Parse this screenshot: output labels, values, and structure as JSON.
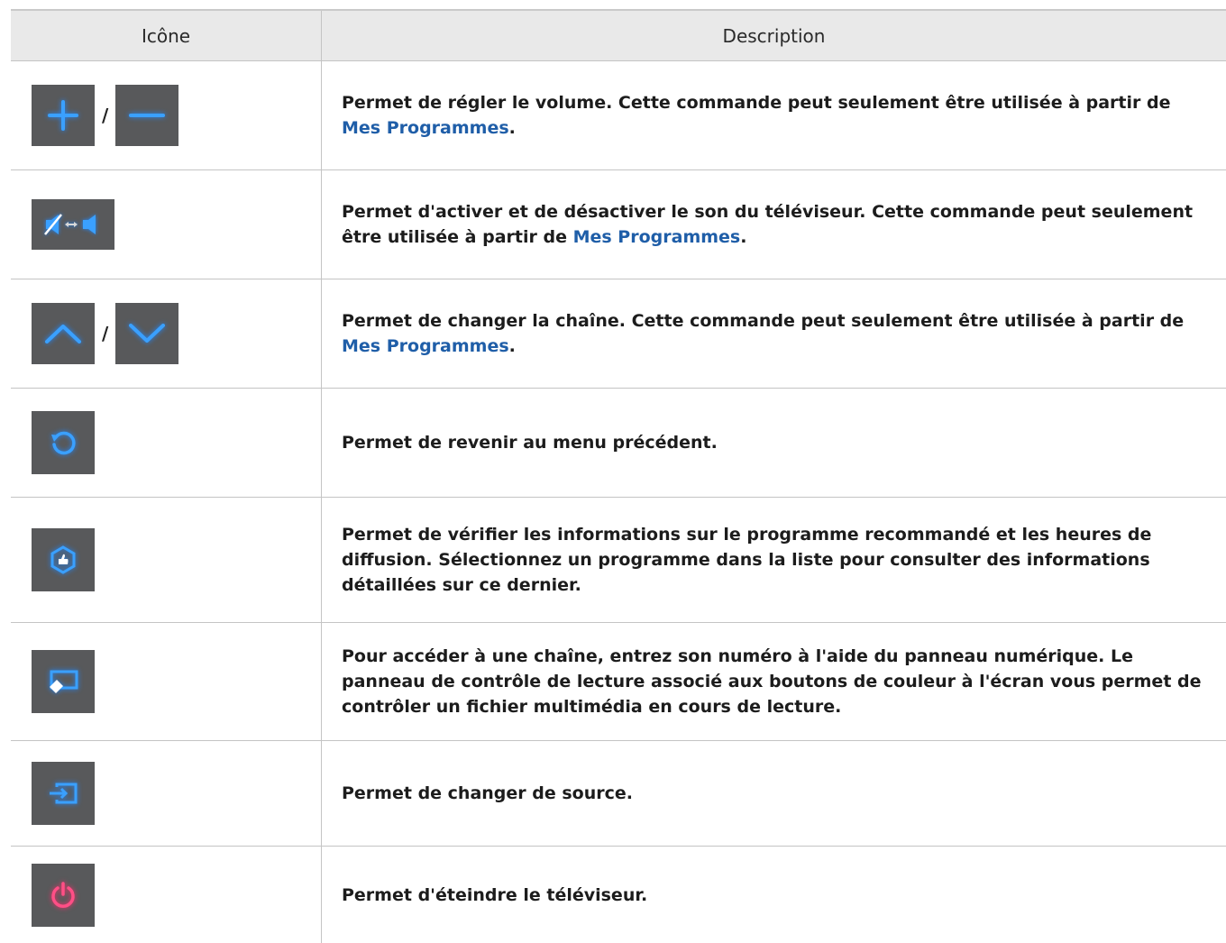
{
  "table": {
    "headers": {
      "icon": "Icône",
      "description": "Description"
    },
    "separator": "/",
    "rows": [
      {
        "icons": [
          "plus-icon",
          "minus-icon"
        ],
        "text": "Permet de régler le volume. Cette commande peut seulement être utilisée à partir de ",
        "link": "Mes Programmes",
        "after": "."
      },
      {
        "icons": [
          "mute-toggle-icon"
        ],
        "text": "Permet d'activer et de désactiver le son du téléviseur. Cette commande peut seulement être utilisée à partir de ",
        "link": "Mes Programmes",
        "after": "."
      },
      {
        "icons": [
          "chevron-up-icon",
          "chevron-down-icon"
        ],
        "text": "Permet de changer la chaîne. Cette commande peut seulement être utilisée à partir de ",
        "link": "Mes Programmes",
        "after": "."
      },
      {
        "icons": [
          "return-icon"
        ],
        "text": "Permet de revenir au menu précédent."
      },
      {
        "icons": [
          "recommendation-icon"
        ],
        "text": "Permet de vérifier les informations sur le programme recommandé et les heures de diffusion. Sélectionnez un programme dans la liste pour consulter des informations détaillées sur ce dernier."
      },
      {
        "icons": [
          "remote-panel-icon"
        ],
        "text": "Pour accéder à une chaîne, entrez son numéro à l'aide du panneau numérique. Le panneau de contrôle de lecture associé aux boutons de couleur à l'écran vous permet de contrôler un fichier multimédia en cours de lecture."
      },
      {
        "icons": [
          "source-icon"
        ],
        "text": "Permet de changer de source."
      },
      {
        "icons": [
          "power-icon"
        ],
        "text": "Permet d'éteindre le téléviseur."
      }
    ]
  },
  "colors": {
    "icon_bg": "#58595b",
    "icon_glow": "#1e88ff",
    "power_glow": "#ff2a6a",
    "link": "#1f5ea8"
  }
}
